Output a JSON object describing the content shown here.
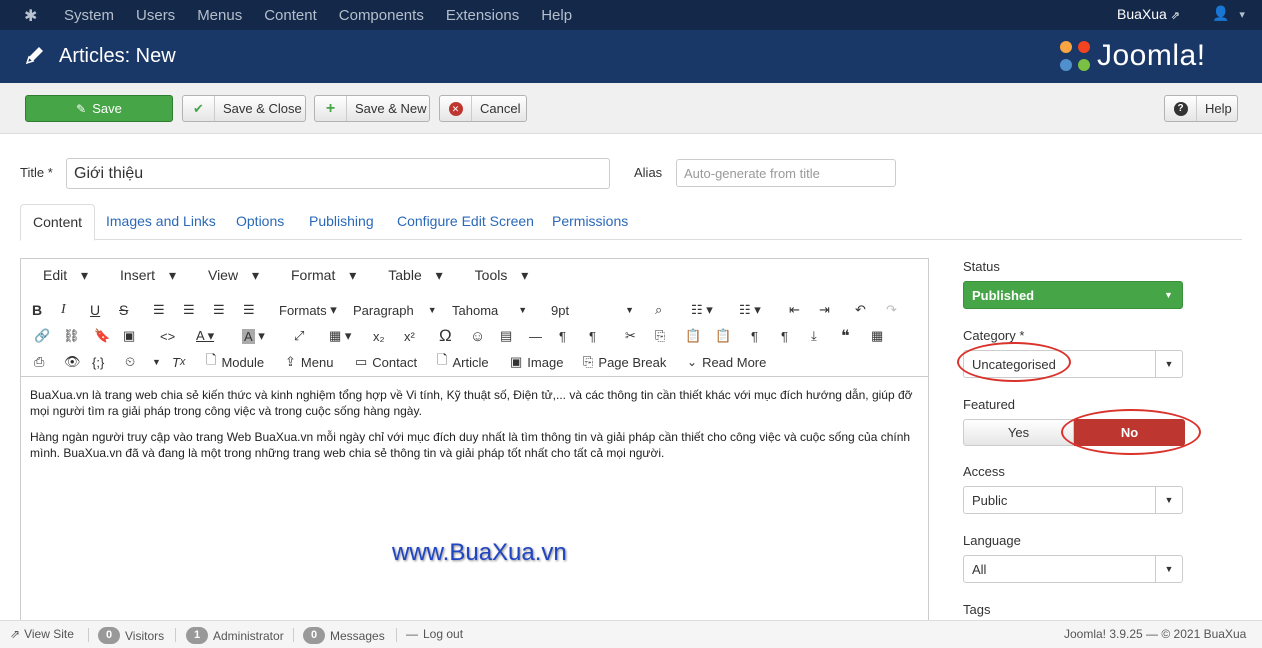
{
  "topnav": {
    "menu": [
      "System",
      "Users",
      "Menus",
      "Content",
      "Components",
      "Extensions",
      "Help"
    ],
    "site_name": "BuaXua",
    "user_caret": "▾"
  },
  "header": {
    "title": "Articles: New",
    "logo_text": "Joomla!"
  },
  "toolbar": {
    "save": "Save",
    "save_close": "Save & Close",
    "save_new": "Save & New",
    "cancel": "Cancel",
    "help": "Help"
  },
  "form": {
    "title_label": "Title *",
    "title_value": "Giới thiệu",
    "alias_label": "Alias",
    "alias_placeholder": "Auto-generate from title"
  },
  "tabs": [
    "Content",
    "Images and Links",
    "Options",
    "Publishing",
    "Configure Edit Screen",
    "Permissions"
  ],
  "editor": {
    "menus": [
      "Edit",
      "Insert",
      "View",
      "Format",
      "Table",
      "Tools"
    ],
    "formats": "Formats",
    "paragraph": "Paragraph",
    "font": "Tahoma",
    "size": "9pt",
    "buttons": {
      "module": "Module",
      "menu": "Menu",
      "contact": "Contact",
      "article": "Article",
      "image": "Image",
      "page_break": "Page Break",
      "read_more": "Read More"
    },
    "paragraphs": [
      "BuaXua.vn là trang web chia sẻ kiến thức và kinh nghiệm tổng hợp về Vi tính, Kỹ thuật số, Điện tử,... và các thông tin cần thiết khác với mục đích hướng dẫn, giúp đỡ mọi người tìm ra giải pháp trong công việc và trong cuộc sống hàng ngày.",
      "Hàng ngàn người truy cập vào trang Web BuaXua.vn mỗi ngày chỉ với mục đích duy nhất là tìm thông tin và giải pháp cần thiết cho công việc và cuộc sống của chính mình. BuaXua.vn đã và đang là một trong những trang web chia sẻ thông tin và giải pháp tốt nhất cho tất cả mọi người."
    ],
    "watermark": "www.BuaXua.vn"
  },
  "sidebar": {
    "status_label": "Status",
    "status_value": "Published",
    "category_label": "Category *",
    "category_value": "Uncategorised",
    "featured_label": "Featured",
    "featured_yes": "Yes",
    "featured_no": "No",
    "access_label": "Access",
    "access_value": "Public",
    "language_label": "Language",
    "language_value": "All",
    "tags_label": "Tags"
  },
  "footer": {
    "view_site": "View Site",
    "visitors_count": "0",
    "visitors": "Visitors",
    "admin_count": "1",
    "admin": "Administrator",
    "messages_count": "0",
    "messages": "Messages",
    "logout": "Log out",
    "version": "Joomla! 3.9.25 — © 2021 BuaXua"
  },
  "colors": {
    "topnav": "#142849",
    "header": "#1a3867",
    "success": "#46a546",
    "danger": "#bd362f",
    "link": "#2a69b8"
  }
}
